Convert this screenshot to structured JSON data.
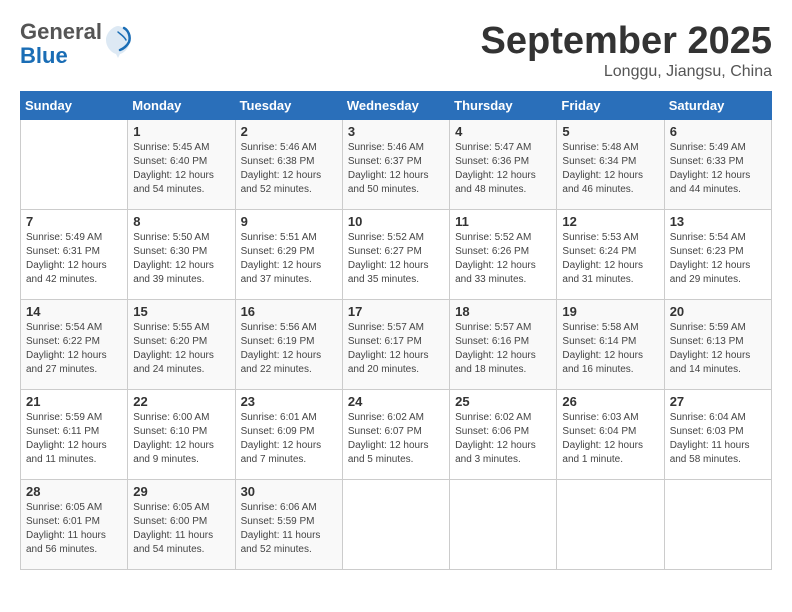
{
  "logo": {
    "general": "General",
    "blue": "Blue"
  },
  "title": {
    "month_year": "September 2025",
    "location": "Longgu, Jiangsu, China"
  },
  "days_of_week": [
    "Sunday",
    "Monday",
    "Tuesday",
    "Wednesday",
    "Thursday",
    "Friday",
    "Saturday"
  ],
  "weeks": [
    [
      {
        "day": "",
        "info": ""
      },
      {
        "day": "1",
        "info": "Sunrise: 5:45 AM\nSunset: 6:40 PM\nDaylight: 12 hours\nand 54 minutes."
      },
      {
        "day": "2",
        "info": "Sunrise: 5:46 AM\nSunset: 6:38 PM\nDaylight: 12 hours\nand 52 minutes."
      },
      {
        "day": "3",
        "info": "Sunrise: 5:46 AM\nSunset: 6:37 PM\nDaylight: 12 hours\nand 50 minutes."
      },
      {
        "day": "4",
        "info": "Sunrise: 5:47 AM\nSunset: 6:36 PM\nDaylight: 12 hours\nand 48 minutes."
      },
      {
        "day": "5",
        "info": "Sunrise: 5:48 AM\nSunset: 6:34 PM\nDaylight: 12 hours\nand 46 minutes."
      },
      {
        "day": "6",
        "info": "Sunrise: 5:49 AM\nSunset: 6:33 PM\nDaylight: 12 hours\nand 44 minutes."
      }
    ],
    [
      {
        "day": "7",
        "info": "Sunrise: 5:49 AM\nSunset: 6:31 PM\nDaylight: 12 hours\nand 42 minutes."
      },
      {
        "day": "8",
        "info": "Sunrise: 5:50 AM\nSunset: 6:30 PM\nDaylight: 12 hours\nand 39 minutes."
      },
      {
        "day": "9",
        "info": "Sunrise: 5:51 AM\nSunset: 6:29 PM\nDaylight: 12 hours\nand 37 minutes."
      },
      {
        "day": "10",
        "info": "Sunrise: 5:52 AM\nSunset: 6:27 PM\nDaylight: 12 hours\nand 35 minutes."
      },
      {
        "day": "11",
        "info": "Sunrise: 5:52 AM\nSunset: 6:26 PM\nDaylight: 12 hours\nand 33 minutes."
      },
      {
        "day": "12",
        "info": "Sunrise: 5:53 AM\nSunset: 6:24 PM\nDaylight: 12 hours\nand 31 minutes."
      },
      {
        "day": "13",
        "info": "Sunrise: 5:54 AM\nSunset: 6:23 PM\nDaylight: 12 hours\nand 29 minutes."
      }
    ],
    [
      {
        "day": "14",
        "info": "Sunrise: 5:54 AM\nSunset: 6:22 PM\nDaylight: 12 hours\nand 27 minutes."
      },
      {
        "day": "15",
        "info": "Sunrise: 5:55 AM\nSunset: 6:20 PM\nDaylight: 12 hours\nand 24 minutes."
      },
      {
        "day": "16",
        "info": "Sunrise: 5:56 AM\nSunset: 6:19 PM\nDaylight: 12 hours\nand 22 minutes."
      },
      {
        "day": "17",
        "info": "Sunrise: 5:57 AM\nSunset: 6:17 PM\nDaylight: 12 hours\nand 20 minutes."
      },
      {
        "day": "18",
        "info": "Sunrise: 5:57 AM\nSunset: 6:16 PM\nDaylight: 12 hours\nand 18 minutes."
      },
      {
        "day": "19",
        "info": "Sunrise: 5:58 AM\nSunset: 6:14 PM\nDaylight: 12 hours\nand 16 minutes."
      },
      {
        "day": "20",
        "info": "Sunrise: 5:59 AM\nSunset: 6:13 PM\nDaylight: 12 hours\nand 14 minutes."
      }
    ],
    [
      {
        "day": "21",
        "info": "Sunrise: 5:59 AM\nSunset: 6:11 PM\nDaylight: 12 hours\nand 11 minutes."
      },
      {
        "day": "22",
        "info": "Sunrise: 6:00 AM\nSunset: 6:10 PM\nDaylight: 12 hours\nand 9 minutes."
      },
      {
        "day": "23",
        "info": "Sunrise: 6:01 AM\nSunset: 6:09 PM\nDaylight: 12 hours\nand 7 minutes."
      },
      {
        "day": "24",
        "info": "Sunrise: 6:02 AM\nSunset: 6:07 PM\nDaylight: 12 hours\nand 5 minutes."
      },
      {
        "day": "25",
        "info": "Sunrise: 6:02 AM\nSunset: 6:06 PM\nDaylight: 12 hours\nand 3 minutes."
      },
      {
        "day": "26",
        "info": "Sunrise: 6:03 AM\nSunset: 6:04 PM\nDaylight: 12 hours\nand 1 minute."
      },
      {
        "day": "27",
        "info": "Sunrise: 6:04 AM\nSunset: 6:03 PM\nDaylight: 11 hours\nand 58 minutes."
      }
    ],
    [
      {
        "day": "28",
        "info": "Sunrise: 6:05 AM\nSunset: 6:01 PM\nDaylight: 11 hours\nand 56 minutes."
      },
      {
        "day": "29",
        "info": "Sunrise: 6:05 AM\nSunset: 6:00 PM\nDaylight: 11 hours\nand 54 minutes."
      },
      {
        "day": "30",
        "info": "Sunrise: 6:06 AM\nSunset: 5:59 PM\nDaylight: 11 hours\nand 52 minutes."
      },
      {
        "day": "",
        "info": ""
      },
      {
        "day": "",
        "info": ""
      },
      {
        "day": "",
        "info": ""
      },
      {
        "day": "",
        "info": ""
      }
    ]
  ]
}
